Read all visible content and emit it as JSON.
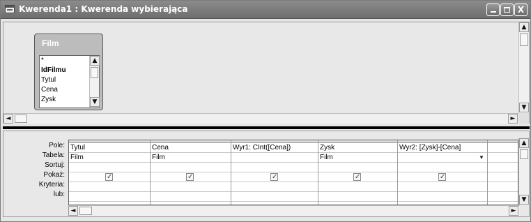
{
  "window": {
    "title": "Kwerenda1 : Kwerenda wybierająca",
    "buttons": {
      "minimize": "_",
      "maximize": "□",
      "close": "X"
    }
  },
  "field_list": {
    "table_name": "Film",
    "fields": [
      {
        "label": "*",
        "bold": false
      },
      {
        "label": "IdFilmu",
        "bold": true
      },
      {
        "label": "Tytul",
        "bold": false
      },
      {
        "label": "Cena",
        "bold": false
      },
      {
        "label": "Zysk",
        "bold": false
      }
    ]
  },
  "grid": {
    "row_labels": [
      "Pole:",
      "Tabela:",
      "Sortuj:",
      "Pokaż:",
      "Kryteria:",
      "lub:"
    ],
    "columns": [
      {
        "field": "Tytul",
        "table": "Film",
        "show": true
      },
      {
        "field": "Cena",
        "table": "Film",
        "show": true
      },
      {
        "field": "Wyr1: CInt([Cena])",
        "table": "",
        "show": true
      },
      {
        "field": "Zysk",
        "table": "Film",
        "show": true
      },
      {
        "field": "Wyr2: [Zysk]-[Cena]",
        "table": "",
        "show": true
      },
      {
        "field": "",
        "table": "",
        "show": false
      }
    ]
  },
  "icons": {
    "scroll_up": "▲",
    "scroll_down": "▼",
    "scroll_left": "◄",
    "scroll_right": "►",
    "dropdown": "▼"
  },
  "colors": {
    "titlebar": "#7a7a7a",
    "background": "#e6e6e6"
  }
}
